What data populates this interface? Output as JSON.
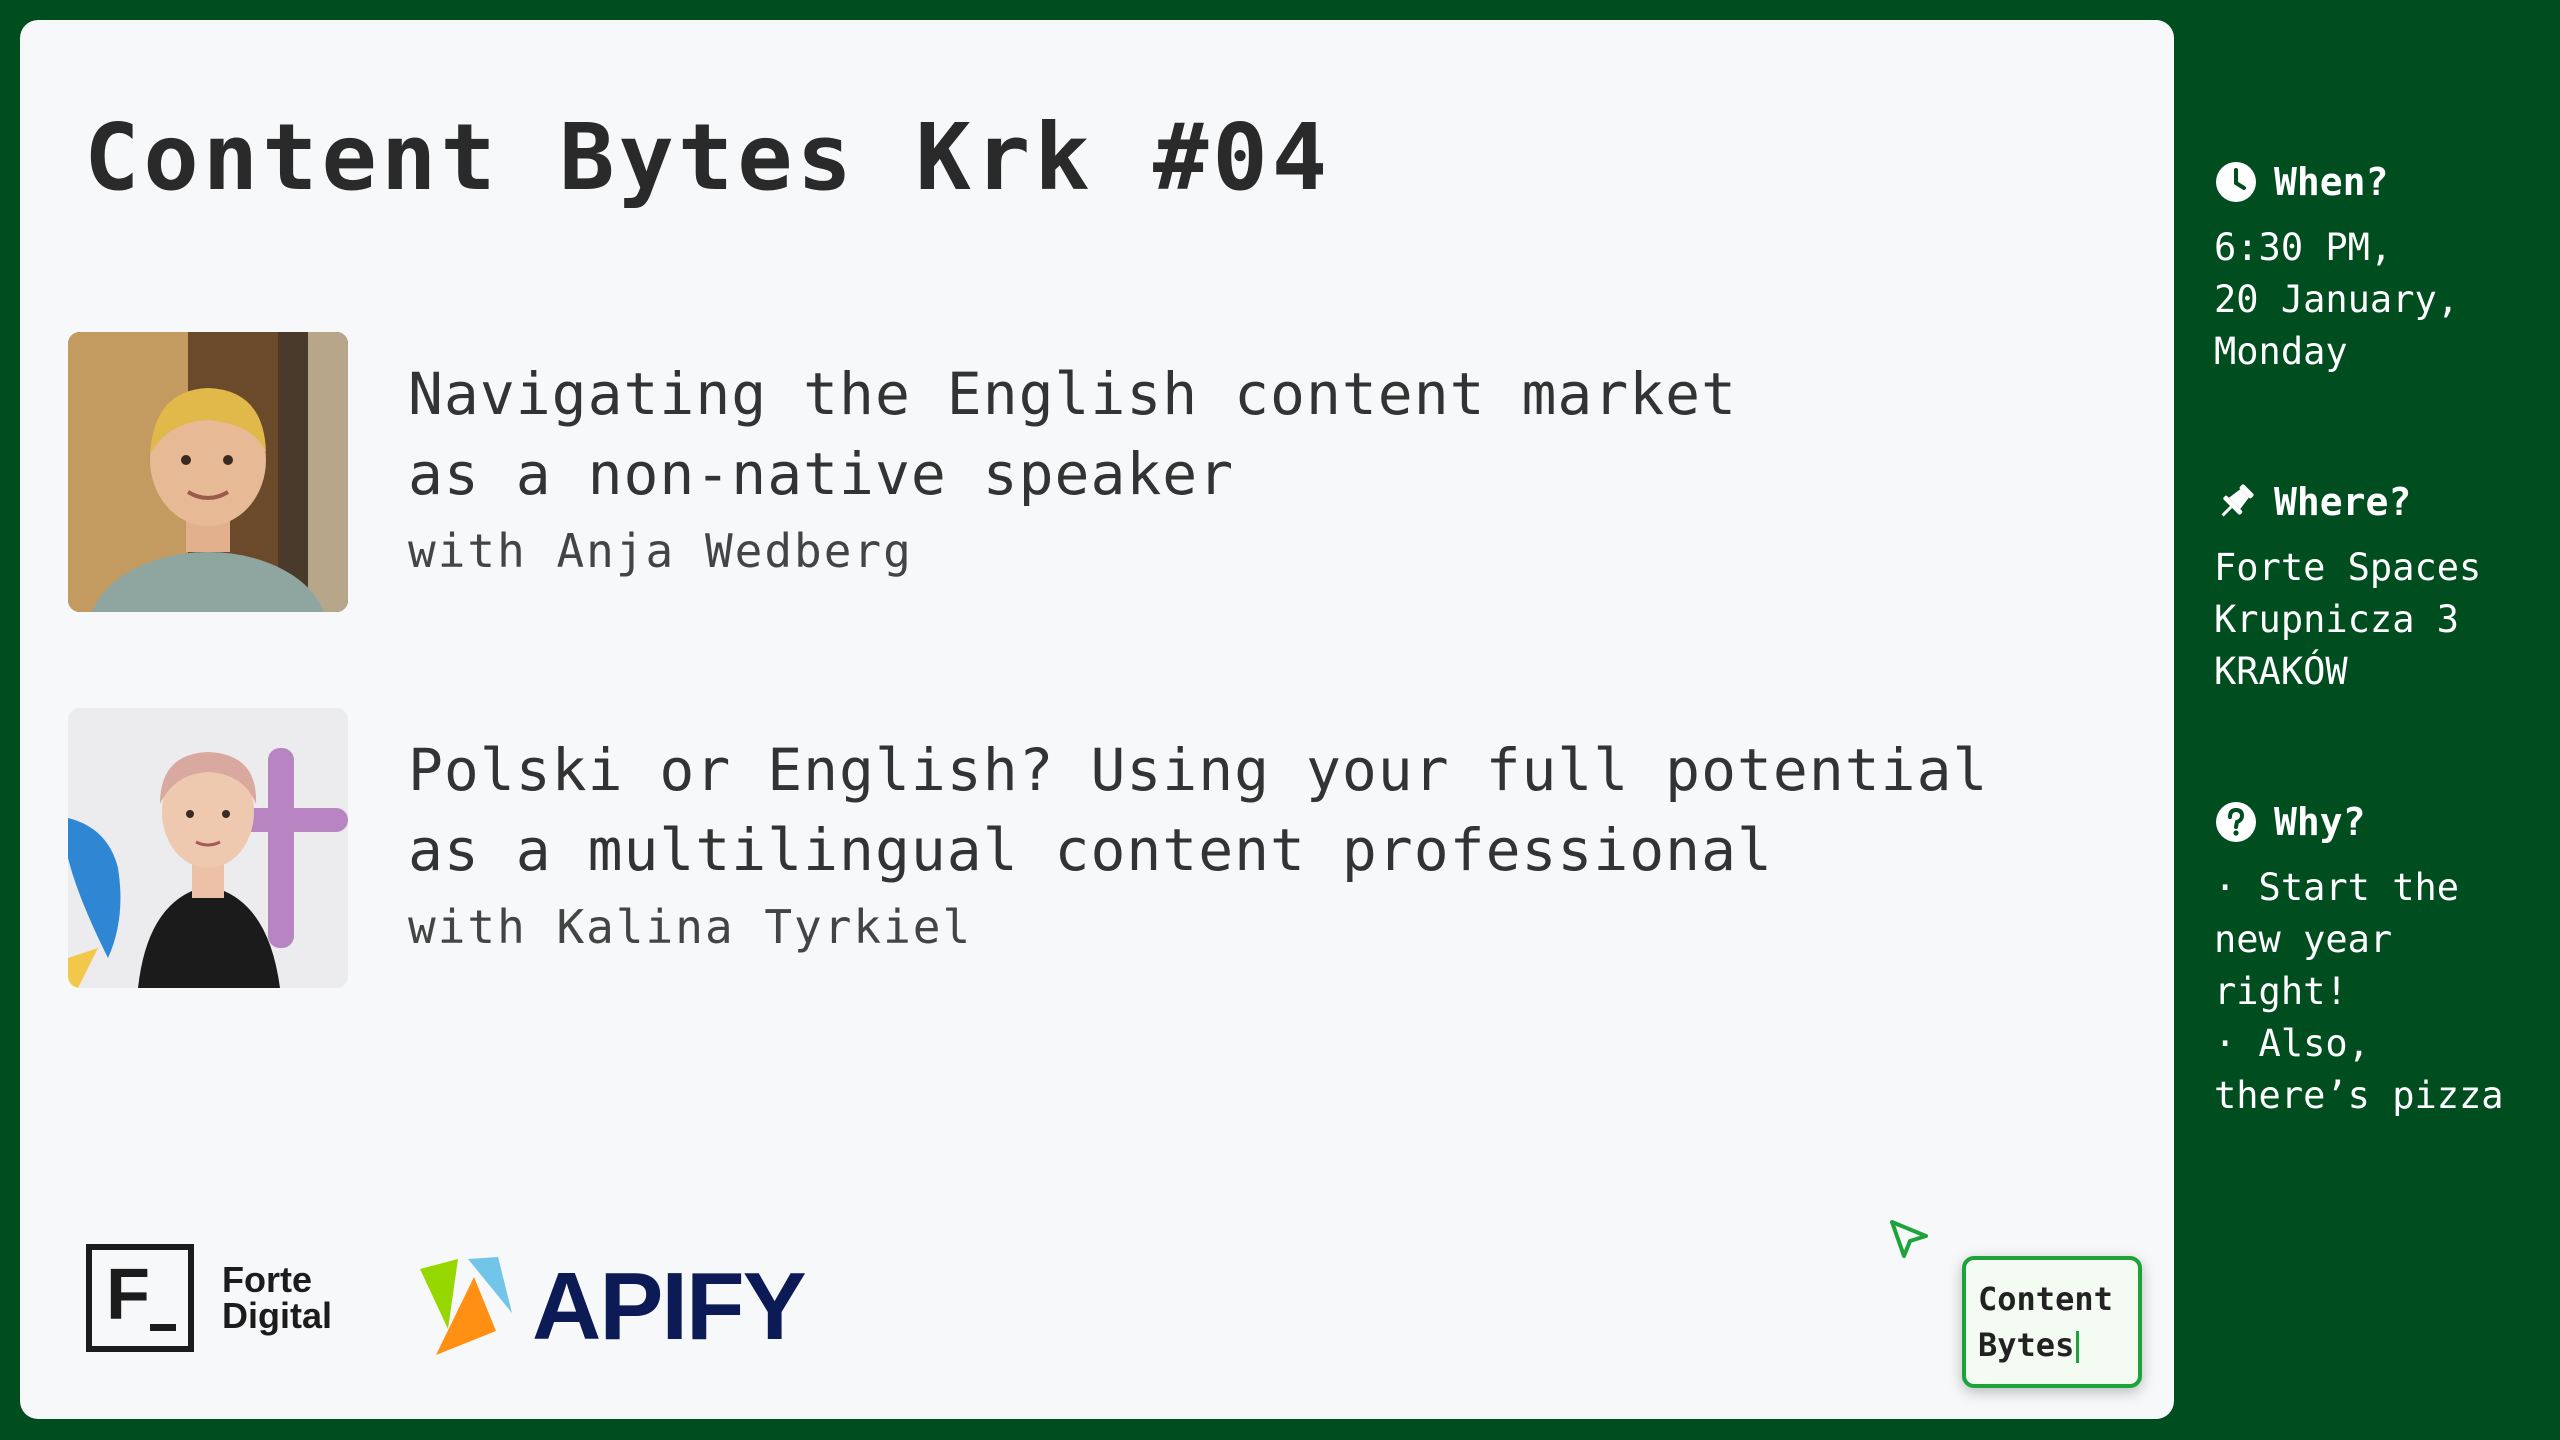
{
  "title": "Content Bytes Krk #04",
  "talks": [
    {
      "title_line1": "Navigating the English content market",
      "title_line2": "as a non-native speaker",
      "speaker": "with Anja Wedberg"
    },
    {
      "title_line1": "Polski or English? Using your full potential",
      "title_line2": "as a multilingual content professional",
      "speaker": "with Kalina Tyrkiel"
    }
  ],
  "sidebar": {
    "when": {
      "label": "When?",
      "icon": "clock-icon",
      "lines": [
        "6:30 PM,",
        "20 January,",
        "Monday"
      ]
    },
    "where": {
      "label": "Where?",
      "icon": "pin-icon",
      "lines": [
        "Forte Spaces",
        "Krupnicza 3",
        "KRAKÓW"
      ]
    },
    "why": {
      "label": "Why?",
      "icon": "question-icon",
      "lines": [
        "· Start the",
        "new year",
        "right!",
        "· Also,",
        "there’s pizza"
      ]
    }
  },
  "logos": {
    "forte": {
      "mark": "F",
      "line1": "Forte",
      "line2": "Digital"
    },
    "apify": {
      "text": "APIFY"
    },
    "content_bytes": {
      "line1": "Content",
      "line2": "Bytes"
    }
  },
  "colors": {
    "background": "#004d1f",
    "card": "#f6f8f9",
    "accent_green": "#1ea33a",
    "apify_navy": "#0c1a55"
  }
}
